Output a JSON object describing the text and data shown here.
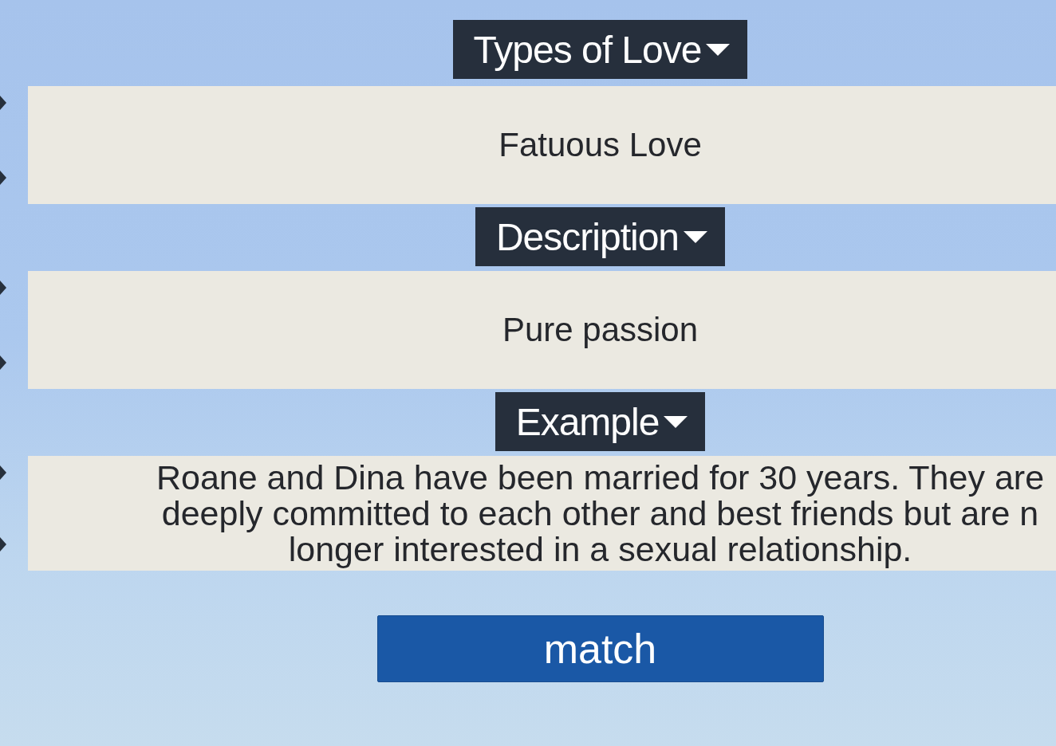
{
  "sections": [
    {
      "heading": "Types of Love",
      "lines": [
        "Fatuous Love"
      ]
    },
    {
      "heading": "Description",
      "lines": [
        "Pure passion"
      ]
    },
    {
      "heading": "Example",
      "lines": [
        "Roane and Dina have been married for 30 years. They are",
        "deeply committed to each other and best friends but are n",
        "longer interested in a sexual relationship."
      ]
    }
  ],
  "button": {
    "label": "match"
  }
}
